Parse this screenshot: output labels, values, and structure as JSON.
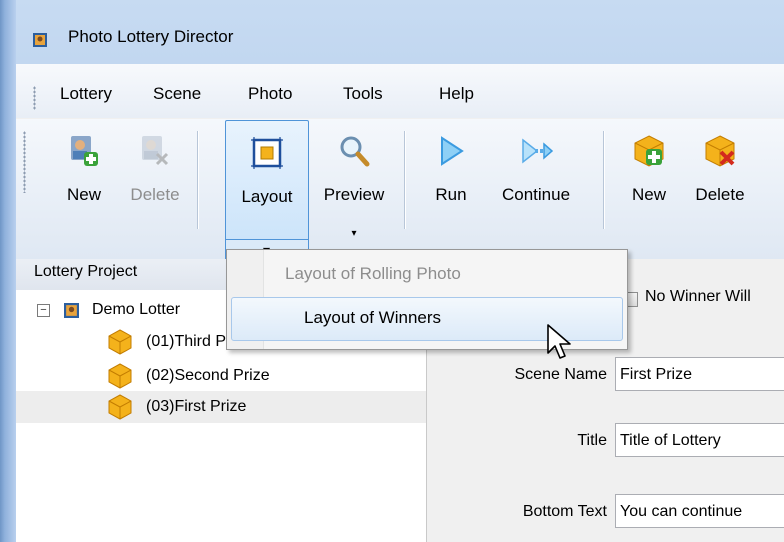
{
  "window": {
    "title": "Photo Lottery Director"
  },
  "menubar": {
    "items": [
      "Lottery",
      "Scene",
      "Photo",
      "Tools",
      "Help"
    ]
  },
  "toolbar": {
    "buttons": [
      {
        "label": "New",
        "icon": "add-user-icon",
        "disabled": false
      },
      {
        "label": "Delete",
        "icon": "delete-user-icon",
        "disabled": true
      },
      {
        "label": "Layout",
        "icon": "layout-icon",
        "disabled": false,
        "has_dropdown": true
      },
      {
        "label": "Preview",
        "icon": "magnifier-icon",
        "disabled": false,
        "has_dropdown": true
      },
      {
        "label": "Run",
        "icon": "play-icon",
        "disabled": false
      },
      {
        "label": "Continue",
        "icon": "continue-icon",
        "disabled": false
      },
      {
        "label": "New",
        "icon": "add-prize-icon",
        "disabled": false
      },
      {
        "label": "Delete",
        "icon": "delete-prize-icon",
        "disabled": false
      }
    ],
    "dropdown_arrow": "▾"
  },
  "left_panel": {
    "header": "Lottery Project",
    "tree": {
      "root": {
        "label": "Demo Lotter",
        "expander": "−"
      },
      "children": [
        {
          "label": "(01)Third Prize"
        },
        {
          "label": "(02)Second Prize"
        },
        {
          "label": "(03)First Prize",
          "selected": true
        }
      ]
    }
  },
  "right_panel": {
    "no_winner_label": "No Winner Will",
    "fields": [
      {
        "label": "Scene Name",
        "value": "First Prize"
      },
      {
        "label": "Title",
        "value": "Title of Lottery"
      },
      {
        "label": "Bottom Text",
        "value": "You can continue"
      }
    ]
  },
  "layout_menu": {
    "items": [
      {
        "label": "Layout of Rolling Photo",
        "disabled": true
      },
      {
        "label": "Layout of Winners",
        "disabled": false,
        "hovered": true
      }
    ]
  },
  "colors": {
    "accent": "#4f94d8",
    "hover_bg": "#dceaf8",
    "disabled_text": "#8d8d8d",
    "prize_icon": "#f4b21b"
  }
}
